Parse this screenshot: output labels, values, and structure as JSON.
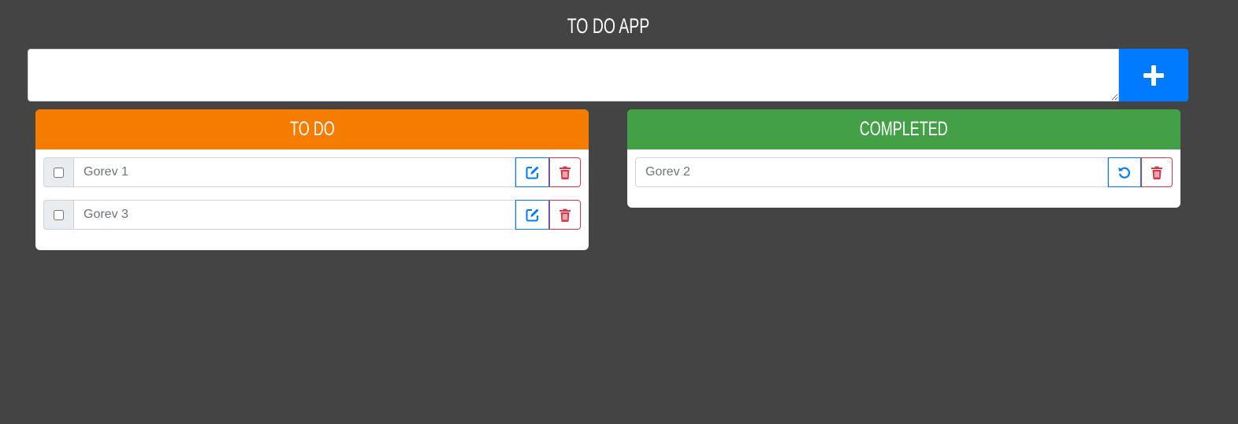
{
  "app": {
    "title": "TO DO APP"
  },
  "add": {
    "input_value": "",
    "button_icon": "plus-icon"
  },
  "todo": {
    "header": "TO DO",
    "color": "#f57c00",
    "items": [
      {
        "text": "Gorev 1",
        "checked": false
      },
      {
        "text": "Gorev 3",
        "checked": false
      }
    ]
  },
  "completed": {
    "header": "COMPLETED",
    "color": "#43a047",
    "items": [
      {
        "text": "Gorev 2"
      }
    ]
  },
  "colors": {
    "background": "#444444",
    "primary": "#007bff",
    "danger": "#dc3545"
  },
  "icons": {
    "edit": "edit-icon",
    "delete": "trash-icon",
    "undo": "undo-icon"
  }
}
